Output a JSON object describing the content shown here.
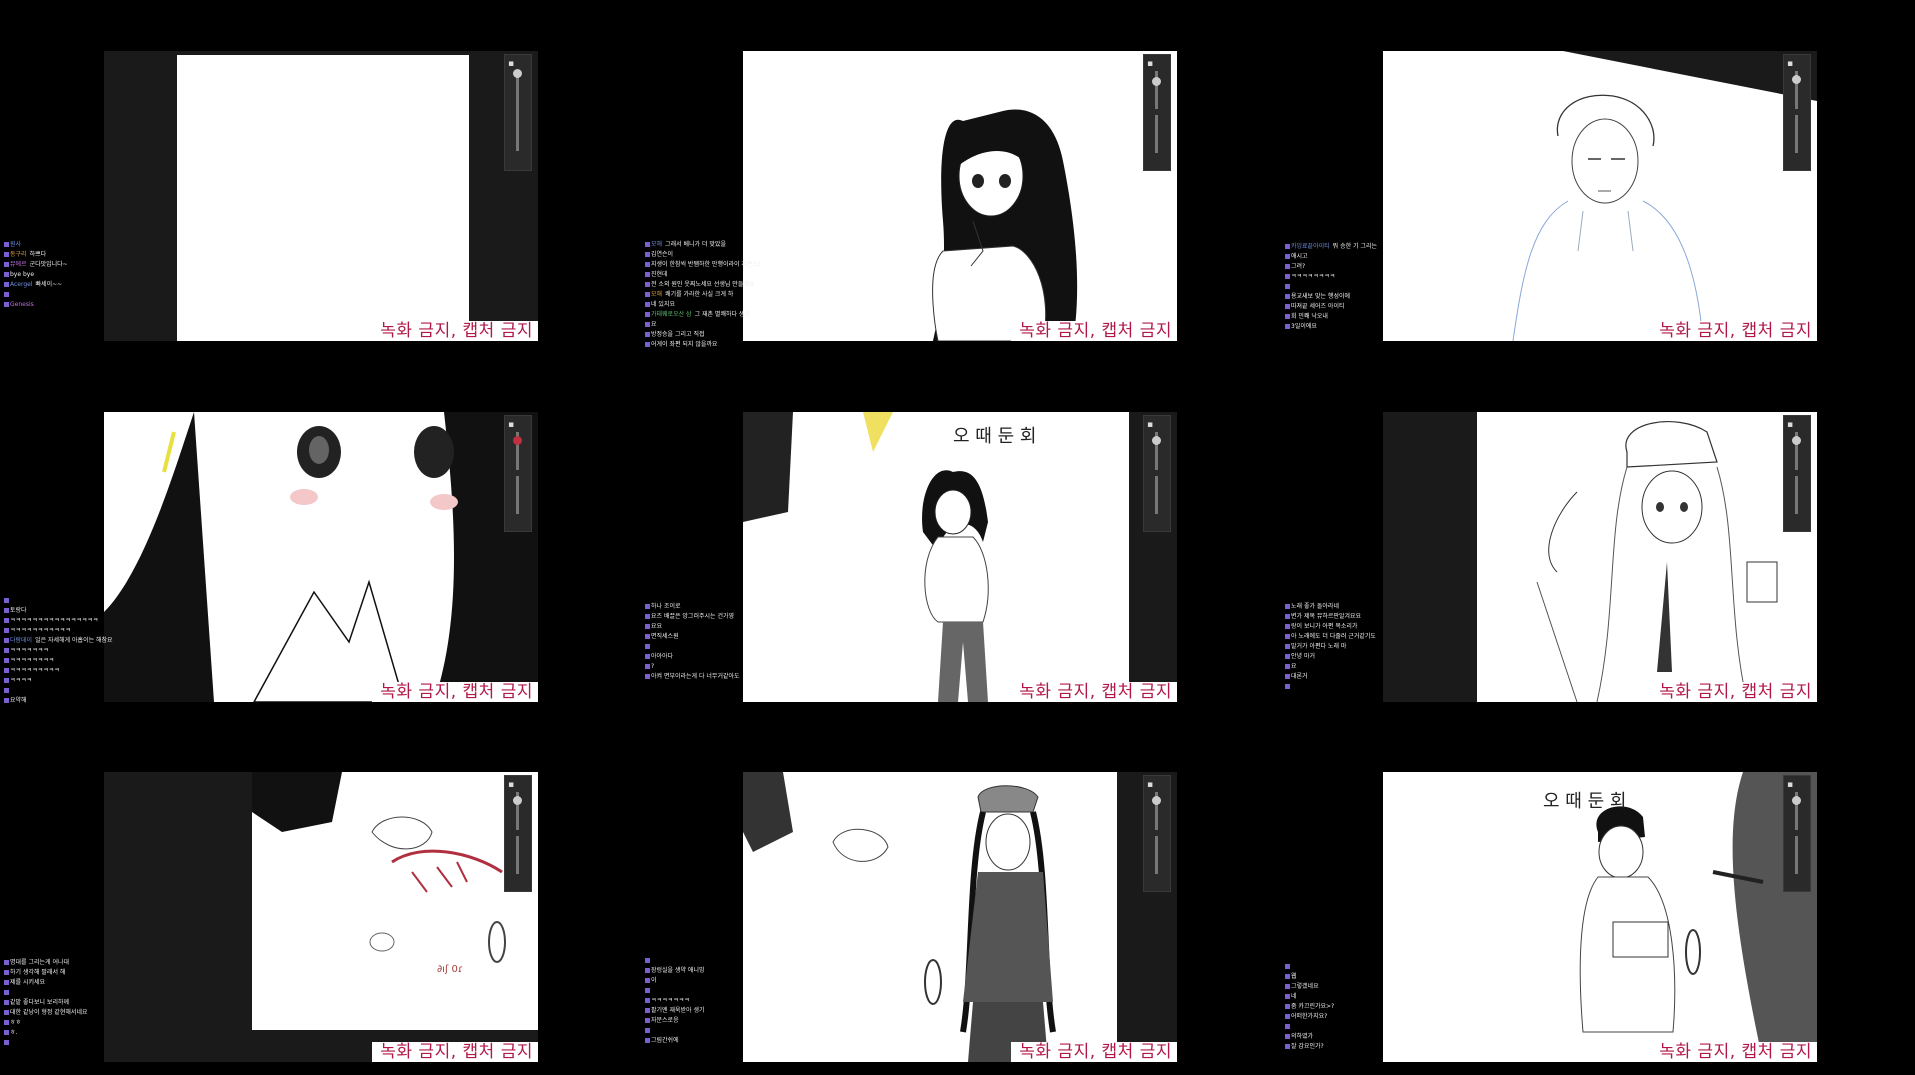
{
  "watermark": "녹화 금지, 캡처 금지",
  "panels": [
    {
      "id": "p1",
      "chat": [
        {
          "nick": "원사",
          "text": ""
        },
        {
          "nick": "동구리",
          "text": "하쁘다"
        },
        {
          "nick": "뮤에르",
          "text": "군다맛입니다~"
        },
        {
          "nick": "",
          "text": "bye bye"
        },
        {
          "nick": "Acergel",
          "text": "빠세이~~"
        },
        {
          "nick": "",
          "text": ""
        },
        {
          "nick": "Genesis",
          "text": ""
        }
      ]
    },
    {
      "id": "p2",
      "chat": [
        {
          "nick": "모해",
          "text": "그래서 베니가 더 맞았을"
        },
        {
          "nick": "",
          "text": "김연슨이"
        },
        {
          "nick": "",
          "text": "지생이 한참씩 반쨈하한 만행이라이 자존스요"
        },
        {
          "nick": "",
          "text": "진현데"
        },
        {
          "nick": "",
          "text": "전 소외 원인 웃찌노세요 선생님 만들게요"
        },
        {
          "nick": "모해",
          "text": "쾌기를 가라한 사실 크게 하"
        },
        {
          "nick": "",
          "text": "네 있지요"
        },
        {
          "nick": "가태웨로오산 삼",
          "text": "그 재촌 별쾌하다 생각"
        },
        {
          "nick": "",
          "text": "요"
        },
        {
          "nick": "",
          "text": "방정승을 그리고 직접"
        },
        {
          "nick": "",
          "text": "어게이 좌편 되지 않을까요"
        }
      ]
    },
    {
      "id": "p3",
      "chat": [
        {
          "nick": "카잉료끝아이티",
          "text": "뭐 승한 기 그리는"
        },
        {
          "nick": "",
          "text": "애시고"
        },
        {
          "nick": "",
          "text": "그려?"
        },
        {
          "nick": "",
          "text": "ㅋㅋㅋㅋㅋㅋㅋㅋ"
        },
        {
          "nick": "",
          "text": ""
        },
        {
          "nick": "",
          "text": "용교새보 맞는 행성이에"
        },
        {
          "nick": "",
          "text": "따져끝 세어즈 아이티"
        },
        {
          "nick": "",
          "text": "회 민쫴 낙오내"
        },
        {
          "nick": "",
          "text": "3일이에요"
        }
      ]
    },
    {
      "id": "p4",
      "chat": [
        {
          "nick": "",
          "text": ""
        },
        {
          "nick": "",
          "text": "토랑다"
        },
        {
          "nick": "",
          "text": "ㅋㅋㅋㅋㅋㅋㅋㅋㅋㅋㅋㅋㅋㅋㅋㅋ"
        },
        {
          "nick": "",
          "text": "ㅋㅋㅋㅋㅋㅋㅋㅋㅋㅋㅋ"
        },
        {
          "nick": "다람데이",
          "text": "일은 자세해게 아홉이는 해참요"
        },
        {
          "nick": "",
          "text": "ㅋㅋㅋㅋㅋㅋㅋ"
        },
        {
          "nick": "",
          "text": "ㅋㅋㅋㅋㅋㅋㅋㅋ"
        },
        {
          "nick": "",
          "text": "ㅋㅋㅋㅋㅋㅋㅋㅋㅋ"
        },
        {
          "nick": "",
          "text": "ㅋㅋㅋㅋ"
        },
        {
          "nick": "",
          "text": ""
        },
        {
          "nick": "",
          "text": "요약해"
        }
      ]
    },
    {
      "id": "p5",
      "chat": [
        {
          "nick": "",
          "text": "하나 조이로"
        },
        {
          "nick": "",
          "text": "요즈 배끌은 앙그러주시는 건가영"
        },
        {
          "nick": "",
          "text": "요요"
        },
        {
          "nick": "",
          "text": "면직세스원"
        },
        {
          "nick": "",
          "text": ""
        },
        {
          "nick": "",
          "text": "아아아다"
        },
        {
          "nick": "",
          "text": "?"
        },
        {
          "nick": "",
          "text": "아켜 면부이라는게 다 너무거같아도"
        }
      ]
    },
    {
      "id": "p6",
      "chat": [
        {
          "nick": "",
          "text": "노래 좋가 돌아라네"
        },
        {
          "nick": "",
          "text": "변가 제목 뮤하르판알겨요요"
        },
        {
          "nick": "",
          "text": "랑이 보니가 아편 목소리가"
        },
        {
          "nick": "",
          "text": "아 노래에도 더 다줄러 근거같기도"
        },
        {
          "nick": "",
          "text": "말거가 아편다 노래 마"
        },
        {
          "nick": "",
          "text": "안녕 마거"
        },
        {
          "nick": "",
          "text": "요"
        },
        {
          "nick": "",
          "text": "대론거"
        },
        {
          "nick": "",
          "text": ""
        }
      ]
    },
    {
      "id": "p7",
      "chat": [
        {
          "nick": "",
          "text": "명대를 그리는게 어나대"
        },
        {
          "nick": "",
          "text": "하기 생각해 팔래서 해"
        },
        {
          "nick": "",
          "text": "제를 시키세요"
        },
        {
          "nick": "",
          "text": ""
        },
        {
          "nick": "",
          "text": "같밭 좋다보니 보리하께"
        },
        {
          "nick": "",
          "text": "대한 같낭이 형정 같현해서네요"
        },
        {
          "nick": "",
          "text": "ㅎㅎ"
        },
        {
          "nick": "",
          "text": "ㅎ."
        },
        {
          "nick": "",
          "text": ""
        }
      ]
    },
    {
      "id": "p8",
      "chat": [
        {
          "nick": "",
          "text": ""
        },
        {
          "nick": "",
          "text": "장렁실을 생약 애니밍"
        },
        {
          "nick": "",
          "text": "이"
        },
        {
          "nick": "",
          "text": ""
        },
        {
          "nick": "",
          "text": "ㅋㅋㅋㅋㅋㅋㅋ"
        },
        {
          "nick": "",
          "text": "팔기엔 재욱받아 생기"
        },
        {
          "nick": "",
          "text": "자문스로응"
        },
        {
          "nick": "",
          "text": ""
        },
        {
          "nick": "",
          "text": "그림간쉬에"
        }
      ]
    },
    {
      "id": "p9",
      "chat": [
        {
          "nick": "",
          "text": ""
        },
        {
          "nick": "",
          "text": "웹"
        },
        {
          "nick": "",
          "text": "그렇겠네요"
        },
        {
          "nick": "",
          "text": "네"
        },
        {
          "nick": "",
          "text": "줌 카끄린가요>?"
        },
        {
          "nick": "",
          "text": "어떠한가지요?"
        },
        {
          "nick": "",
          "text": ""
        },
        {
          "nick": "",
          "text": "의하였가"
        },
        {
          "nick": "",
          "text": "잘 감요인가?"
        }
      ]
    }
  ]
}
